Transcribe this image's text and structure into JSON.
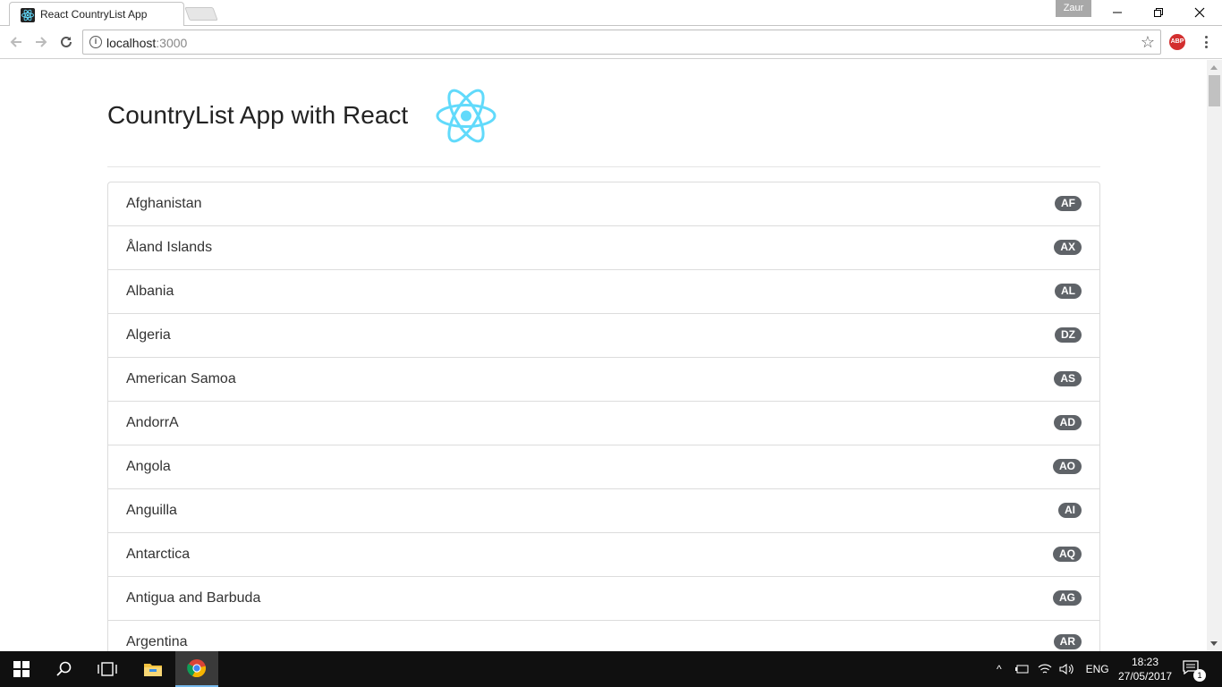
{
  "browser": {
    "tab_title": "React CountryList App",
    "profile_name": "Zaur",
    "url_host": "localhost",
    "url_port": ":3000"
  },
  "page": {
    "heading": "CountryList App with React",
    "logo_color": "#61dafb",
    "badge_color": "#5f6368",
    "countries": [
      {
        "name": "Afghanistan",
        "code": "AF"
      },
      {
        "name": "Åland Islands",
        "code": "AX"
      },
      {
        "name": "Albania",
        "code": "AL"
      },
      {
        "name": "Algeria",
        "code": "DZ"
      },
      {
        "name": "American Samoa",
        "code": "AS"
      },
      {
        "name": "AndorrA",
        "code": "AD"
      },
      {
        "name": "Angola",
        "code": "AO"
      },
      {
        "name": "Anguilla",
        "code": "AI"
      },
      {
        "name": "Antarctica",
        "code": "AQ"
      },
      {
        "name": "Antigua and Barbuda",
        "code": "AG"
      },
      {
        "name": "Argentina",
        "code": "AR"
      }
    ]
  },
  "taskbar": {
    "language": "ENG",
    "time": "18:23",
    "date": "27/05/2017",
    "notification_count": "1"
  }
}
